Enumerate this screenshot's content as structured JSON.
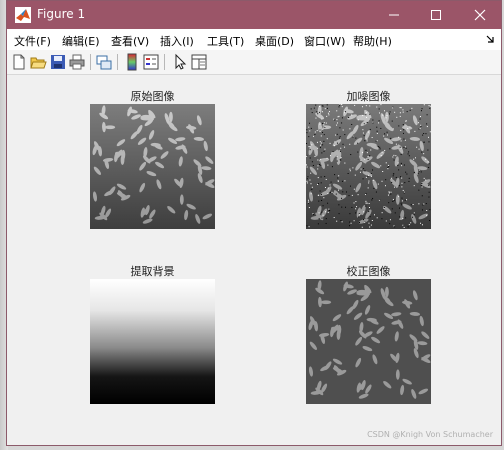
{
  "window": {
    "title": "Figure 1"
  },
  "menu": {
    "items": [
      "文件(F)",
      "编辑(E)",
      "查看(V)",
      "插入(I)",
      "工具(T)",
      "桌面(D)",
      "窗口(W)",
      "帮助(H)"
    ]
  },
  "toolbar": {
    "buttons": [
      "new-figure-icon",
      "open-file-icon",
      "save-icon",
      "print-icon",
      "link-plot-icon",
      "colorbar-icon",
      "legend-icon",
      "pointer-icon",
      "property-editor-icon"
    ]
  },
  "subplots": [
    {
      "title": "原始图像",
      "image": "grayscale rice grains, darker toward the bottom"
    },
    {
      "title": "加噪图像",
      "image": "rice grains with salt-and-pepper noise"
    },
    {
      "title": "提取背景",
      "image": "vertical gradient, white at top to black at bottom"
    },
    {
      "title": "校正图像",
      "image": "rice grains with uniform background"
    }
  ],
  "watermark": "CSDN @Knigh Von Schumacher",
  "colors": {
    "titlebar": "#9b5568",
    "canvas": "#f0f0f0",
    "menubar": "#ffffff"
  }
}
